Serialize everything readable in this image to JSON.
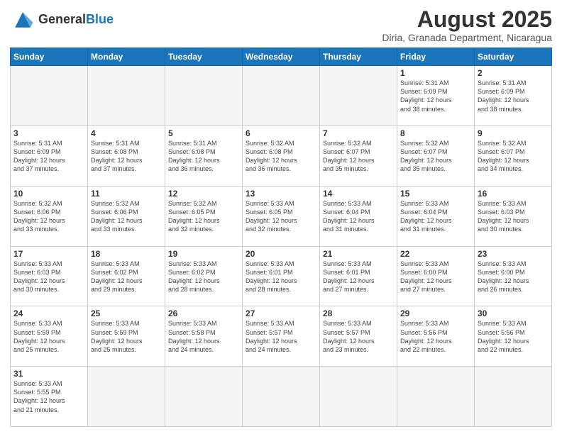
{
  "header": {
    "logo_general": "General",
    "logo_blue": "Blue",
    "title": "August 2025",
    "subtitle": "Diria, Granada Department, Nicaragua"
  },
  "weekdays": [
    "Sunday",
    "Monday",
    "Tuesday",
    "Wednesday",
    "Thursday",
    "Friday",
    "Saturday"
  ],
  "weeks": [
    [
      {
        "day": "",
        "info": "",
        "empty": true
      },
      {
        "day": "",
        "info": "",
        "empty": true
      },
      {
        "day": "",
        "info": "",
        "empty": true
      },
      {
        "day": "",
        "info": "",
        "empty": true
      },
      {
        "day": "",
        "info": "",
        "empty": true
      },
      {
        "day": "1",
        "info": "Sunrise: 5:31 AM\nSunset: 6:09 PM\nDaylight: 12 hours\nand 38 minutes.",
        "empty": false
      },
      {
        "day": "2",
        "info": "Sunrise: 5:31 AM\nSunset: 6:09 PM\nDaylight: 12 hours\nand 38 minutes.",
        "empty": false
      }
    ],
    [
      {
        "day": "3",
        "info": "Sunrise: 5:31 AM\nSunset: 6:09 PM\nDaylight: 12 hours\nand 37 minutes.",
        "empty": false
      },
      {
        "day": "4",
        "info": "Sunrise: 5:31 AM\nSunset: 6:08 PM\nDaylight: 12 hours\nand 37 minutes.",
        "empty": false
      },
      {
        "day": "5",
        "info": "Sunrise: 5:31 AM\nSunset: 6:08 PM\nDaylight: 12 hours\nand 36 minutes.",
        "empty": false
      },
      {
        "day": "6",
        "info": "Sunrise: 5:32 AM\nSunset: 6:08 PM\nDaylight: 12 hours\nand 36 minutes.",
        "empty": false
      },
      {
        "day": "7",
        "info": "Sunrise: 5:32 AM\nSunset: 6:07 PM\nDaylight: 12 hours\nand 35 minutes.",
        "empty": false
      },
      {
        "day": "8",
        "info": "Sunrise: 5:32 AM\nSunset: 6:07 PM\nDaylight: 12 hours\nand 35 minutes.",
        "empty": false
      },
      {
        "day": "9",
        "info": "Sunrise: 5:32 AM\nSunset: 6:07 PM\nDaylight: 12 hours\nand 34 minutes.",
        "empty": false
      }
    ],
    [
      {
        "day": "10",
        "info": "Sunrise: 5:32 AM\nSunset: 6:06 PM\nDaylight: 12 hours\nand 33 minutes.",
        "empty": false
      },
      {
        "day": "11",
        "info": "Sunrise: 5:32 AM\nSunset: 6:06 PM\nDaylight: 12 hours\nand 33 minutes.",
        "empty": false
      },
      {
        "day": "12",
        "info": "Sunrise: 5:32 AM\nSunset: 6:05 PM\nDaylight: 12 hours\nand 32 minutes.",
        "empty": false
      },
      {
        "day": "13",
        "info": "Sunrise: 5:33 AM\nSunset: 6:05 PM\nDaylight: 12 hours\nand 32 minutes.",
        "empty": false
      },
      {
        "day": "14",
        "info": "Sunrise: 5:33 AM\nSunset: 6:04 PM\nDaylight: 12 hours\nand 31 minutes.",
        "empty": false
      },
      {
        "day": "15",
        "info": "Sunrise: 5:33 AM\nSunset: 6:04 PM\nDaylight: 12 hours\nand 31 minutes.",
        "empty": false
      },
      {
        "day": "16",
        "info": "Sunrise: 5:33 AM\nSunset: 6:03 PM\nDaylight: 12 hours\nand 30 minutes.",
        "empty": false
      }
    ],
    [
      {
        "day": "17",
        "info": "Sunrise: 5:33 AM\nSunset: 6:03 PM\nDaylight: 12 hours\nand 30 minutes.",
        "empty": false
      },
      {
        "day": "18",
        "info": "Sunrise: 5:33 AM\nSunset: 6:02 PM\nDaylight: 12 hours\nand 29 minutes.",
        "empty": false
      },
      {
        "day": "19",
        "info": "Sunrise: 5:33 AM\nSunset: 6:02 PM\nDaylight: 12 hours\nand 28 minutes.",
        "empty": false
      },
      {
        "day": "20",
        "info": "Sunrise: 5:33 AM\nSunset: 6:01 PM\nDaylight: 12 hours\nand 28 minutes.",
        "empty": false
      },
      {
        "day": "21",
        "info": "Sunrise: 5:33 AM\nSunset: 6:01 PM\nDaylight: 12 hours\nand 27 minutes.",
        "empty": false
      },
      {
        "day": "22",
        "info": "Sunrise: 5:33 AM\nSunset: 6:00 PM\nDaylight: 12 hours\nand 27 minutes.",
        "empty": false
      },
      {
        "day": "23",
        "info": "Sunrise: 5:33 AM\nSunset: 6:00 PM\nDaylight: 12 hours\nand 26 minutes.",
        "empty": false
      }
    ],
    [
      {
        "day": "24",
        "info": "Sunrise: 5:33 AM\nSunset: 5:59 PM\nDaylight: 12 hours\nand 25 minutes.",
        "empty": false
      },
      {
        "day": "25",
        "info": "Sunrise: 5:33 AM\nSunset: 5:59 PM\nDaylight: 12 hours\nand 25 minutes.",
        "empty": false
      },
      {
        "day": "26",
        "info": "Sunrise: 5:33 AM\nSunset: 5:58 PM\nDaylight: 12 hours\nand 24 minutes.",
        "empty": false
      },
      {
        "day": "27",
        "info": "Sunrise: 5:33 AM\nSunset: 5:57 PM\nDaylight: 12 hours\nand 24 minutes.",
        "empty": false
      },
      {
        "day": "28",
        "info": "Sunrise: 5:33 AM\nSunset: 5:57 PM\nDaylight: 12 hours\nand 23 minutes.",
        "empty": false
      },
      {
        "day": "29",
        "info": "Sunrise: 5:33 AM\nSunset: 5:56 PM\nDaylight: 12 hours\nand 22 minutes.",
        "empty": false
      },
      {
        "day": "30",
        "info": "Sunrise: 5:33 AM\nSunset: 5:56 PM\nDaylight: 12 hours\nand 22 minutes.",
        "empty": false
      }
    ],
    [
      {
        "day": "31",
        "info": "Sunrise: 5:33 AM\nSunset: 5:55 PM\nDaylight: 12 hours\nand 21 minutes.",
        "empty": false
      },
      {
        "day": "",
        "info": "",
        "empty": true
      },
      {
        "day": "",
        "info": "",
        "empty": true
      },
      {
        "day": "",
        "info": "",
        "empty": true
      },
      {
        "day": "",
        "info": "",
        "empty": true
      },
      {
        "day": "",
        "info": "",
        "empty": true
      },
      {
        "day": "",
        "info": "",
        "empty": true
      }
    ]
  ]
}
